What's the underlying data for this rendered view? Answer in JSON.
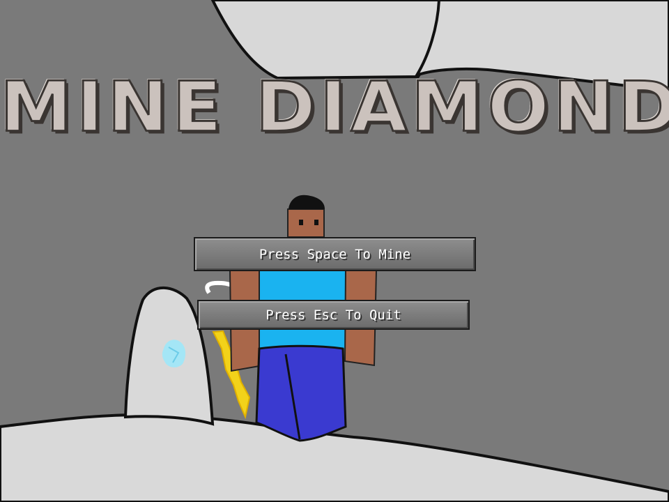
{
  "game": {
    "title": "MINE DIAMONDS"
  },
  "menu": {
    "mine_label": "Press Space To Mine",
    "quit_label": "Press Esc To Quit"
  },
  "colors": {
    "cave_wall": "#7a7a7a",
    "sky_light": "#d6d6d6",
    "ground": "#d9d9d9",
    "shirt": "#1ab3f0",
    "pants": "#3a3ad0",
    "skin": "#a9674a",
    "pickaxe": "#f2d21a",
    "diamond": "#9fe4f5"
  }
}
